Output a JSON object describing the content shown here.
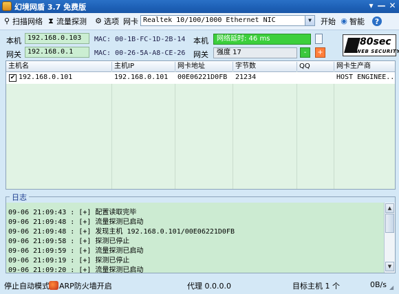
{
  "window": {
    "title": "幻境网盾 3.7 免费版",
    "min_glyph": "—",
    "close_glyph": "✕",
    "menu_glyph": "▾"
  },
  "toolbar": {
    "scan_label": "扫描网络",
    "traffic_label": "流量探测",
    "options_label": "选项",
    "nic_label": "网卡",
    "nic_value": "Realtek 10/100/1000 Ethernet NIC",
    "start_label": "开始",
    "smart_label": "智能",
    "help_glyph": "?"
  },
  "info": {
    "local_label": "本机",
    "local_ip": "192.168.0.103",
    "local_mac": "MAC: 00-1B-FC-1D-2B-14",
    "gateway_label": "网关",
    "gateway_ip": "192.168.0.1",
    "gateway_mac": "MAC: 00-26-5A-A8-CE-26",
    "right_local_label": "本机",
    "latency": "网络延时:  46 ms",
    "right_gateway_label": "网关",
    "strength": "强度 17",
    "minus": "-",
    "plus": "+",
    "brand_big": "80sec",
    "brand_small": "WEB SECURITY"
  },
  "hosts": {
    "columns": [
      "主机名",
      "主机IP",
      "网卡地址",
      "字节数",
      "QQ",
      "网卡生产商"
    ],
    "rows": [
      {
        "checked": "✔",
        "name": "192.168.0.101",
        "ip": "192.168.0.101",
        "mac": "00E06221D0FB",
        "bytes": "21234",
        "qq": "",
        "vendor": "HOST ENGINEE..."
      }
    ]
  },
  "log": {
    "title": "日志",
    "lines": [
      "09-06 21:09:43 : [+] 配置读取完毕",
      "09-06 21:09:48 : [+] 流量探测已启动",
      "09-06 21:09:48 : [+] 发现主机 192.168.0.101/00E06221D0FB",
      "09-06 21:09:58 : [+] 探测已停止",
      "09-06 21:09:59 : [+] 流量探测已启动",
      "09-06 21:09:19 : [+] 探测已停止",
      "09-06 21:09:20 : [+] 流量探测已启动"
    ]
  },
  "status": {
    "auto_mode": "停止自动模式",
    "arp_firewall": "ARP防火墙开启",
    "proxy": "代理 0.0.0.0",
    "target": "目标主机 1 个",
    "speed": "0B/s"
  }
}
